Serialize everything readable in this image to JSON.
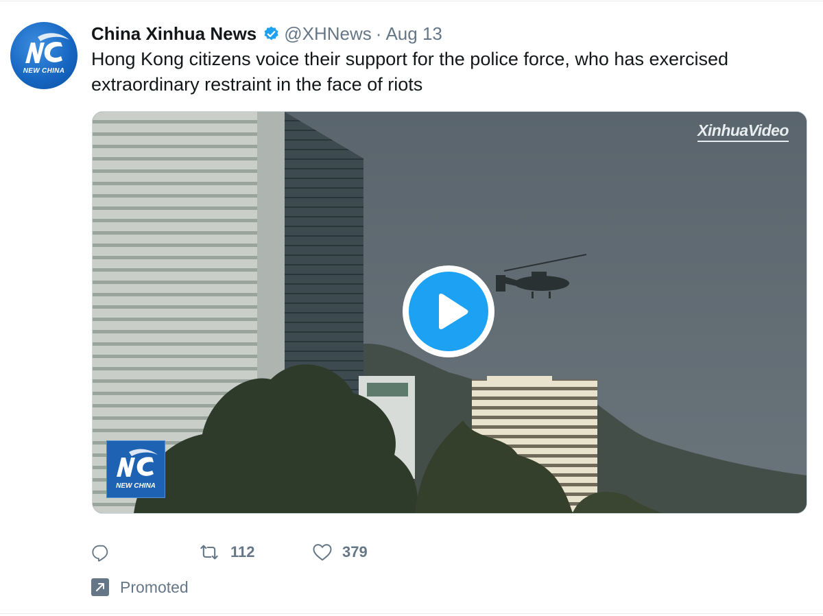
{
  "tweet": {
    "display_name": "China Xinhua News",
    "handle": "@XHNews",
    "separator": "·",
    "date": "Aug 13",
    "text": "Hong Kong citizens voice their support for the police force, who has exercised extraordinary restraint in the face of riots",
    "avatar_label": "NEW CHINA"
  },
  "media": {
    "watermark": "XinhuaVideo",
    "logo_label": "NEW CHINA",
    "play_icon": "play-icon"
  },
  "actions": {
    "reply_count": "",
    "retweet_count": "112",
    "like_count": "379"
  },
  "promoted": {
    "label": "Promoted"
  },
  "colors": {
    "brand_blue": "#1da1f2",
    "muted_text": "#657786",
    "text": "#14171a"
  }
}
